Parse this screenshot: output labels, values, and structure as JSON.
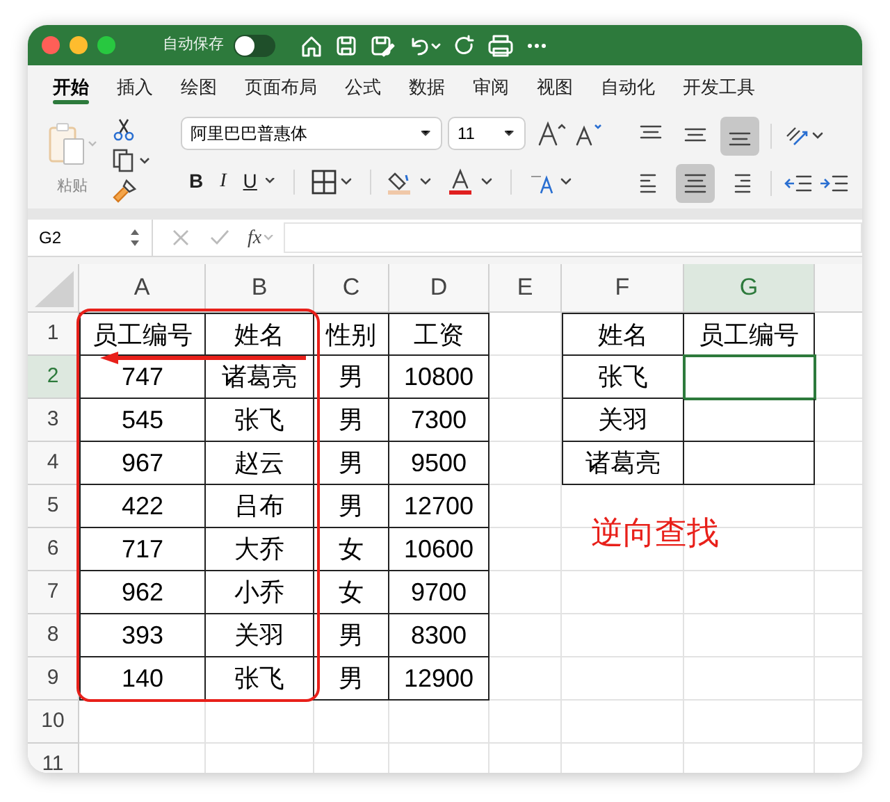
{
  "title_bar": {
    "autosave_label": "自动保存",
    "autosave_on": false
  },
  "tabs": [
    {
      "label": "开始",
      "selected": true
    },
    {
      "label": "插入",
      "selected": false
    },
    {
      "label": "绘图",
      "selected": false
    },
    {
      "label": "页面布局",
      "selected": false
    },
    {
      "label": "公式",
      "selected": false
    },
    {
      "label": "数据",
      "selected": false
    },
    {
      "label": "审阅",
      "selected": false
    },
    {
      "label": "视图",
      "selected": false
    },
    {
      "label": "自动化",
      "selected": false
    },
    {
      "label": "开发工具",
      "selected": false
    }
  ],
  "ribbon": {
    "paste_label": "粘贴",
    "font_name": "阿里巴巴普惠体",
    "font_size": "11",
    "bold": "B",
    "italic": "I",
    "underline": "U",
    "vertical_align": [
      {
        "kind": "top",
        "selected": false
      },
      {
        "kind": "middle",
        "selected": false
      },
      {
        "kind": "bottom",
        "selected": true
      }
    ],
    "horizontal_align": [
      {
        "kind": "left",
        "selected": false
      },
      {
        "kind": "center",
        "selected": true
      },
      {
        "kind": "right",
        "selected": false
      }
    ]
  },
  "formula_bar": {
    "name_box": "G2",
    "fx": "fx"
  },
  "sheet": {
    "columns": [
      {
        "label": "A",
        "selected": false
      },
      {
        "label": "B",
        "selected": false
      },
      {
        "label": "C",
        "selected": false
      },
      {
        "label": "D",
        "selected": false
      },
      {
        "label": "E",
        "selected": false
      },
      {
        "label": "F",
        "selected": false
      },
      {
        "label": "G",
        "selected": true
      }
    ],
    "rows": [
      {
        "number": "1",
        "selected": false,
        "cells": [
          "员工编号",
          "姓名",
          "性别",
          "工资",
          "",
          "姓名",
          "员工编号"
        ]
      },
      {
        "number": "2",
        "selected": true,
        "cells": [
          "747",
          "诸葛亮",
          "男",
          "10800",
          "",
          "张飞",
          ""
        ]
      },
      {
        "number": "3",
        "selected": false,
        "cells": [
          "545",
          "张飞",
          "男",
          "7300",
          "",
          "关羽",
          ""
        ]
      },
      {
        "number": "4",
        "selected": false,
        "cells": [
          "967",
          "赵云",
          "男",
          "9500",
          "",
          "诸葛亮",
          ""
        ]
      },
      {
        "number": "5",
        "selected": false,
        "cells": [
          "422",
          "吕布",
          "男",
          "12700",
          "",
          "",
          ""
        ]
      },
      {
        "number": "6",
        "selected": false,
        "cells": [
          "717",
          "大乔",
          "女",
          "10600",
          "",
          "",
          ""
        ]
      },
      {
        "number": "7",
        "selected": false,
        "cells": [
          "962",
          "小乔",
          "女",
          "9700",
          "",
          "",
          ""
        ]
      },
      {
        "number": "8",
        "selected": false,
        "cells": [
          "393",
          "关羽",
          "男",
          "8300",
          "",
          "",
          ""
        ]
      },
      {
        "number": "9",
        "selected": false,
        "cells": [
          "140",
          "张飞",
          "男",
          "12900",
          "",
          "",
          ""
        ]
      },
      {
        "number": "10",
        "selected": false,
        "cells": [
          "",
          "",
          "",
          "",
          "",
          "",
          ""
        ]
      },
      {
        "number": "11",
        "selected": false,
        "cells": [
          "",
          "",
          "",
          "",
          "",
          "",
          ""
        ]
      }
    ],
    "annotation": "逆向查找"
  }
}
